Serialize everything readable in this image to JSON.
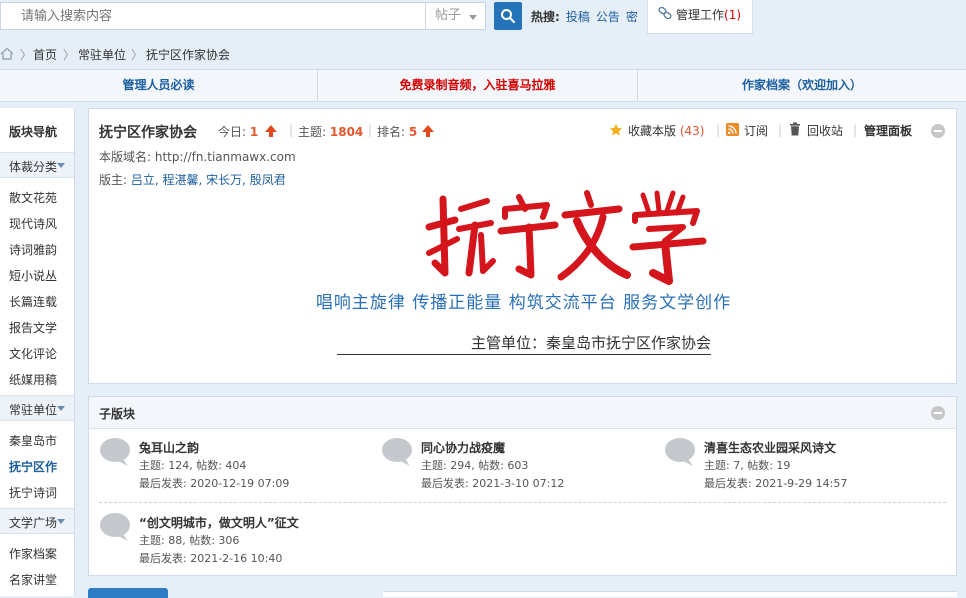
{
  "search": {
    "placeholder": "请输入搜索内容",
    "scope": "帖子"
  },
  "hot": {
    "label": "热搜:",
    "items": [
      "投稿",
      "公告",
      "密"
    ]
  },
  "dropdown": {
    "label": "管理工作",
    "count": "(1)"
  },
  "breadcrumb": [
    "首页",
    "常驻单位",
    "抚宁区作家协会"
  ],
  "notice": {
    "left": "管理人员必读",
    "middle": "免费录制音频，入驻喜马拉雅",
    "right": "作家档案（欢迎加入）",
    "colors": {
      "left": "#1d5f9f",
      "middle": "#d40000",
      "right": "#1d5f9f"
    }
  },
  "sidebar": {
    "title": "版块导航",
    "groups": [
      {
        "label": "体裁分类",
        "items": [
          "散文花苑",
          "现代诗风",
          "诗词雅韵",
          "短小说丛",
          "长篇连载",
          "报告文学",
          "文化评论",
          "纸媒用稿"
        ]
      },
      {
        "label": "常驻单位",
        "items": [
          "秦皇岛市",
          "抚宁区作",
          "抚宁诗词"
        ]
      },
      {
        "label": "文学广场",
        "items": [
          "作家档案",
          "名家讲堂"
        ]
      }
    ],
    "active": "抚宁区作"
  },
  "forum": {
    "name": "抚宁区作家协会",
    "today_label": "今日:",
    "today": "1",
    "topics_label": "主题:",
    "topics": "1804",
    "rank_label": "排名:",
    "rank": "5",
    "domain": "本版域名: http://fn.tianmawx.com",
    "moderators_label": "版主:",
    "moderators": "吕立, 程湛馨, 宋长万, 殷凤君",
    "favorite": "收藏本版",
    "favorite_count": "(43)",
    "subscribe": "订阅",
    "recycle": "回收站",
    "panel": "管理面板",
    "banner": {
      "logo_text": "抚宁文学",
      "slogan": "唱响主旋律  传播正能量  构筑交流平台  服务文学创作",
      "unit": "主管单位：秦皇岛市抚宁区作家协会"
    }
  },
  "subforums": {
    "title": "子版块",
    "items": [
      {
        "name": "兔耳山之韵",
        "stats": "主题: 124, 帖数: 404",
        "last": "最后发表: 2020-12-19 07:09"
      },
      {
        "name": "同心协力战疫魔",
        "stats": "主题: 294, 帖数: 603",
        "last": "最后发表: 2021-3-10 07:12"
      },
      {
        "name": "清喜生态农业园采风诗文",
        "stats": "主题: 7, 帖数: 19",
        "last": "最后发表: 2021-9-29 14:57"
      },
      {
        "name": "“创文明城市，做文明人”征文",
        "stats": "主题: 88, 帖数: 306",
        "last": "最后发表: 2021-2-16 10:40"
      }
    ]
  }
}
